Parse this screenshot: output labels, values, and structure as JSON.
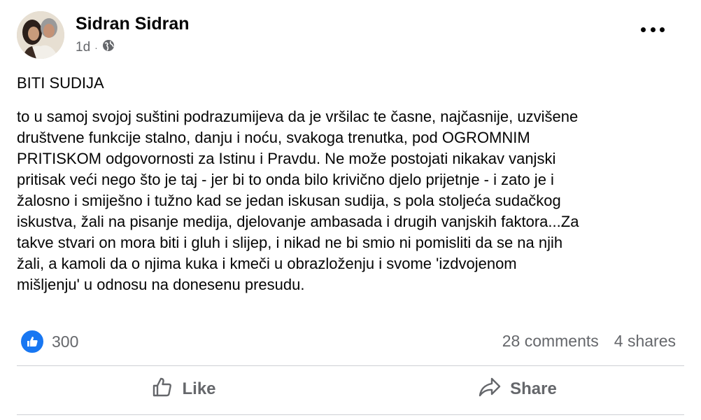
{
  "post": {
    "author": "Sidran Sidran",
    "time": "1d",
    "dot": "·",
    "audience_icon": "globe-icon",
    "title": "BITI SUDIJA",
    "body": "to u samoj svojoj suštini podrazumijeva da je vršilac te časne, najčasnije, uzvišene\ndruštvene funkcije stalno, danju i noću, svakoga trenutka, pod OGROMNIM\nPRITISKOM odgovornosti za Istinu i Pravdu. Ne može postojati nikakav vanjski\npritisak veći nego što je taj - jer bi to onda bilo krivično djelo prijetnje - i zato je i\nžalosno i smiješno i tužno kad se jedan iskusan sudija, s pola stoljeća sudačkog\niskustva, žali na pisanje medija, djelovanje ambasada i drugih vanjskih faktora...Za\ntakve stvari on mora biti i gluh i slijep, i nikad ne bi smio ni pomisliti da se na njih\nžali, a kamoli da o njima kuka i kmeči u obrazloženju i svome 'izdvojenom\nmišljenju' u odnosu na donesenu presudu."
  },
  "reactions": {
    "icon": "like-reaction-icon",
    "count": "300",
    "comments": "28 comments",
    "shares": "4 shares"
  },
  "actions": {
    "like_label": "Like",
    "share_label": "Share"
  },
  "colors": {
    "accent": "#1877f2",
    "secondary_text": "#65676b",
    "divider": "#ced0d4"
  }
}
